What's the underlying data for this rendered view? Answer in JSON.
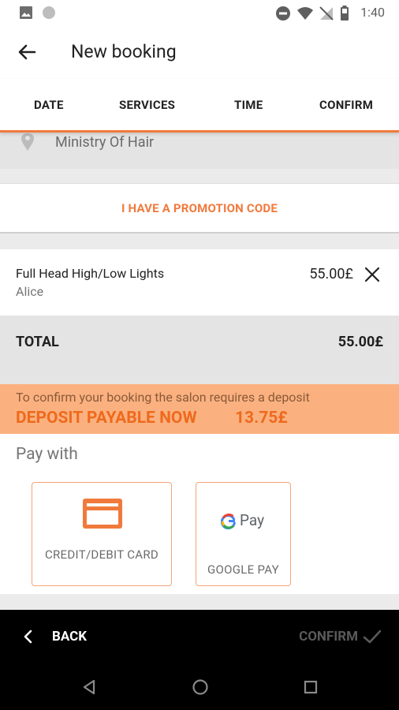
{
  "status_bar": {
    "time": "1:40"
  },
  "app_bar": {
    "title": "New booking"
  },
  "steps": [
    "DATE",
    "SERVICES",
    "TIME",
    "CONFIRM"
  ],
  "salon": {
    "name": "Ministry Of Hair"
  },
  "promo": {
    "label": "I HAVE A PROMOTION CODE"
  },
  "service": {
    "name": "Full Head High/Low Lights",
    "staff": "Alice",
    "price": "55.00£"
  },
  "total": {
    "label": "TOTAL",
    "amount": "55.00£"
  },
  "deposit": {
    "note": "To confirm your booking the salon requires a deposit",
    "label": "DEPOSIT PAYABLE NOW",
    "amount": "13.75£"
  },
  "payment": {
    "heading": "Pay with",
    "options": [
      {
        "label": "CREDIT/DEBIT CARD",
        "icon": "credit-card-icon"
      },
      {
        "label": "GOOGLE PAY",
        "logo_text": "Pay",
        "icon": "google-pay-logo"
      }
    ]
  },
  "bottom_bar": {
    "back": "BACK",
    "confirm": "CONFIRM"
  },
  "colors": {
    "accent": "#f07a3c",
    "deposit_bg": "#fbb17f",
    "gray_bg": "#e4e4e4"
  }
}
